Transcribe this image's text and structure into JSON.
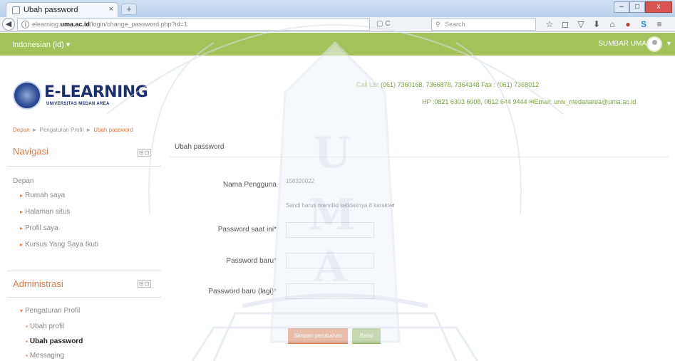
{
  "browser": {
    "tab_title": "Ubah password",
    "tab_close": "×",
    "new_tab": "+",
    "window_buttons": {
      "minimize": "–",
      "maximize": "□",
      "close": "x"
    },
    "url_prefix": "elearning.",
    "url_domain": "uma.ac.id",
    "url_path": "/login/change_password.php?id=1",
    "search_placeholder": "Search",
    "url_icons": "▢  C",
    "toolbar_icons": [
      "☆",
      "◻",
      "▽",
      "⬇",
      "⌂",
      "●",
      "S",
      "≡"
    ]
  },
  "site_bar": {
    "language": "Indonesian (id) ▾",
    "user_name": "SUMBAR UMA",
    "caret": "▾"
  },
  "brand": {
    "title": "E-LEARNING",
    "subtitle": "UNIVERSITAS MEDAN AREA",
    "contact_line1": "Call Us: (061) 7360168, 7366878, 7364348 Fax : (061) 7368012",
    "contact_line2": "HP :0821 6303 6908, 0812 644 9444  ✉Email: univ_medanarea@uma.ac.id"
  },
  "breadcrumb": {
    "home": "Depan",
    "profile_settings": "Pengaturan Profil",
    "current": "Ubah password",
    "separator": "►"
  },
  "sidebar": {
    "navigation": {
      "title": "Navigasi",
      "control": "⊟⊡",
      "items": [
        "Depan",
        "Rumah saya",
        "Halaman situs",
        "Profil saya",
        "Kursus Yang Saya Ikuti"
      ]
    },
    "administration": {
      "title": "Administrasi",
      "control": "⊟⊡",
      "items": [
        "Pengaturan Profil",
        "Ubah profil",
        "Ubah password",
        "Messaging"
      ]
    }
  },
  "form": {
    "heading": "Ubah password",
    "username_label": "Nama Pengguna",
    "username_value": "158320022",
    "password_rule": "Sandi harus memiliki setidaknya 8 karakter",
    "current_password_label": "Password saat ini*",
    "new_password_label": "Password baru*",
    "new_password_again_label": "Password baru (lagi)*",
    "save_button": "Simpan perubahan",
    "cancel_button": "Batal"
  },
  "colors": {
    "accent_orange": "#e07b48",
    "site_green": "#a3c25a",
    "brand_blue": "#1c2f6e"
  }
}
